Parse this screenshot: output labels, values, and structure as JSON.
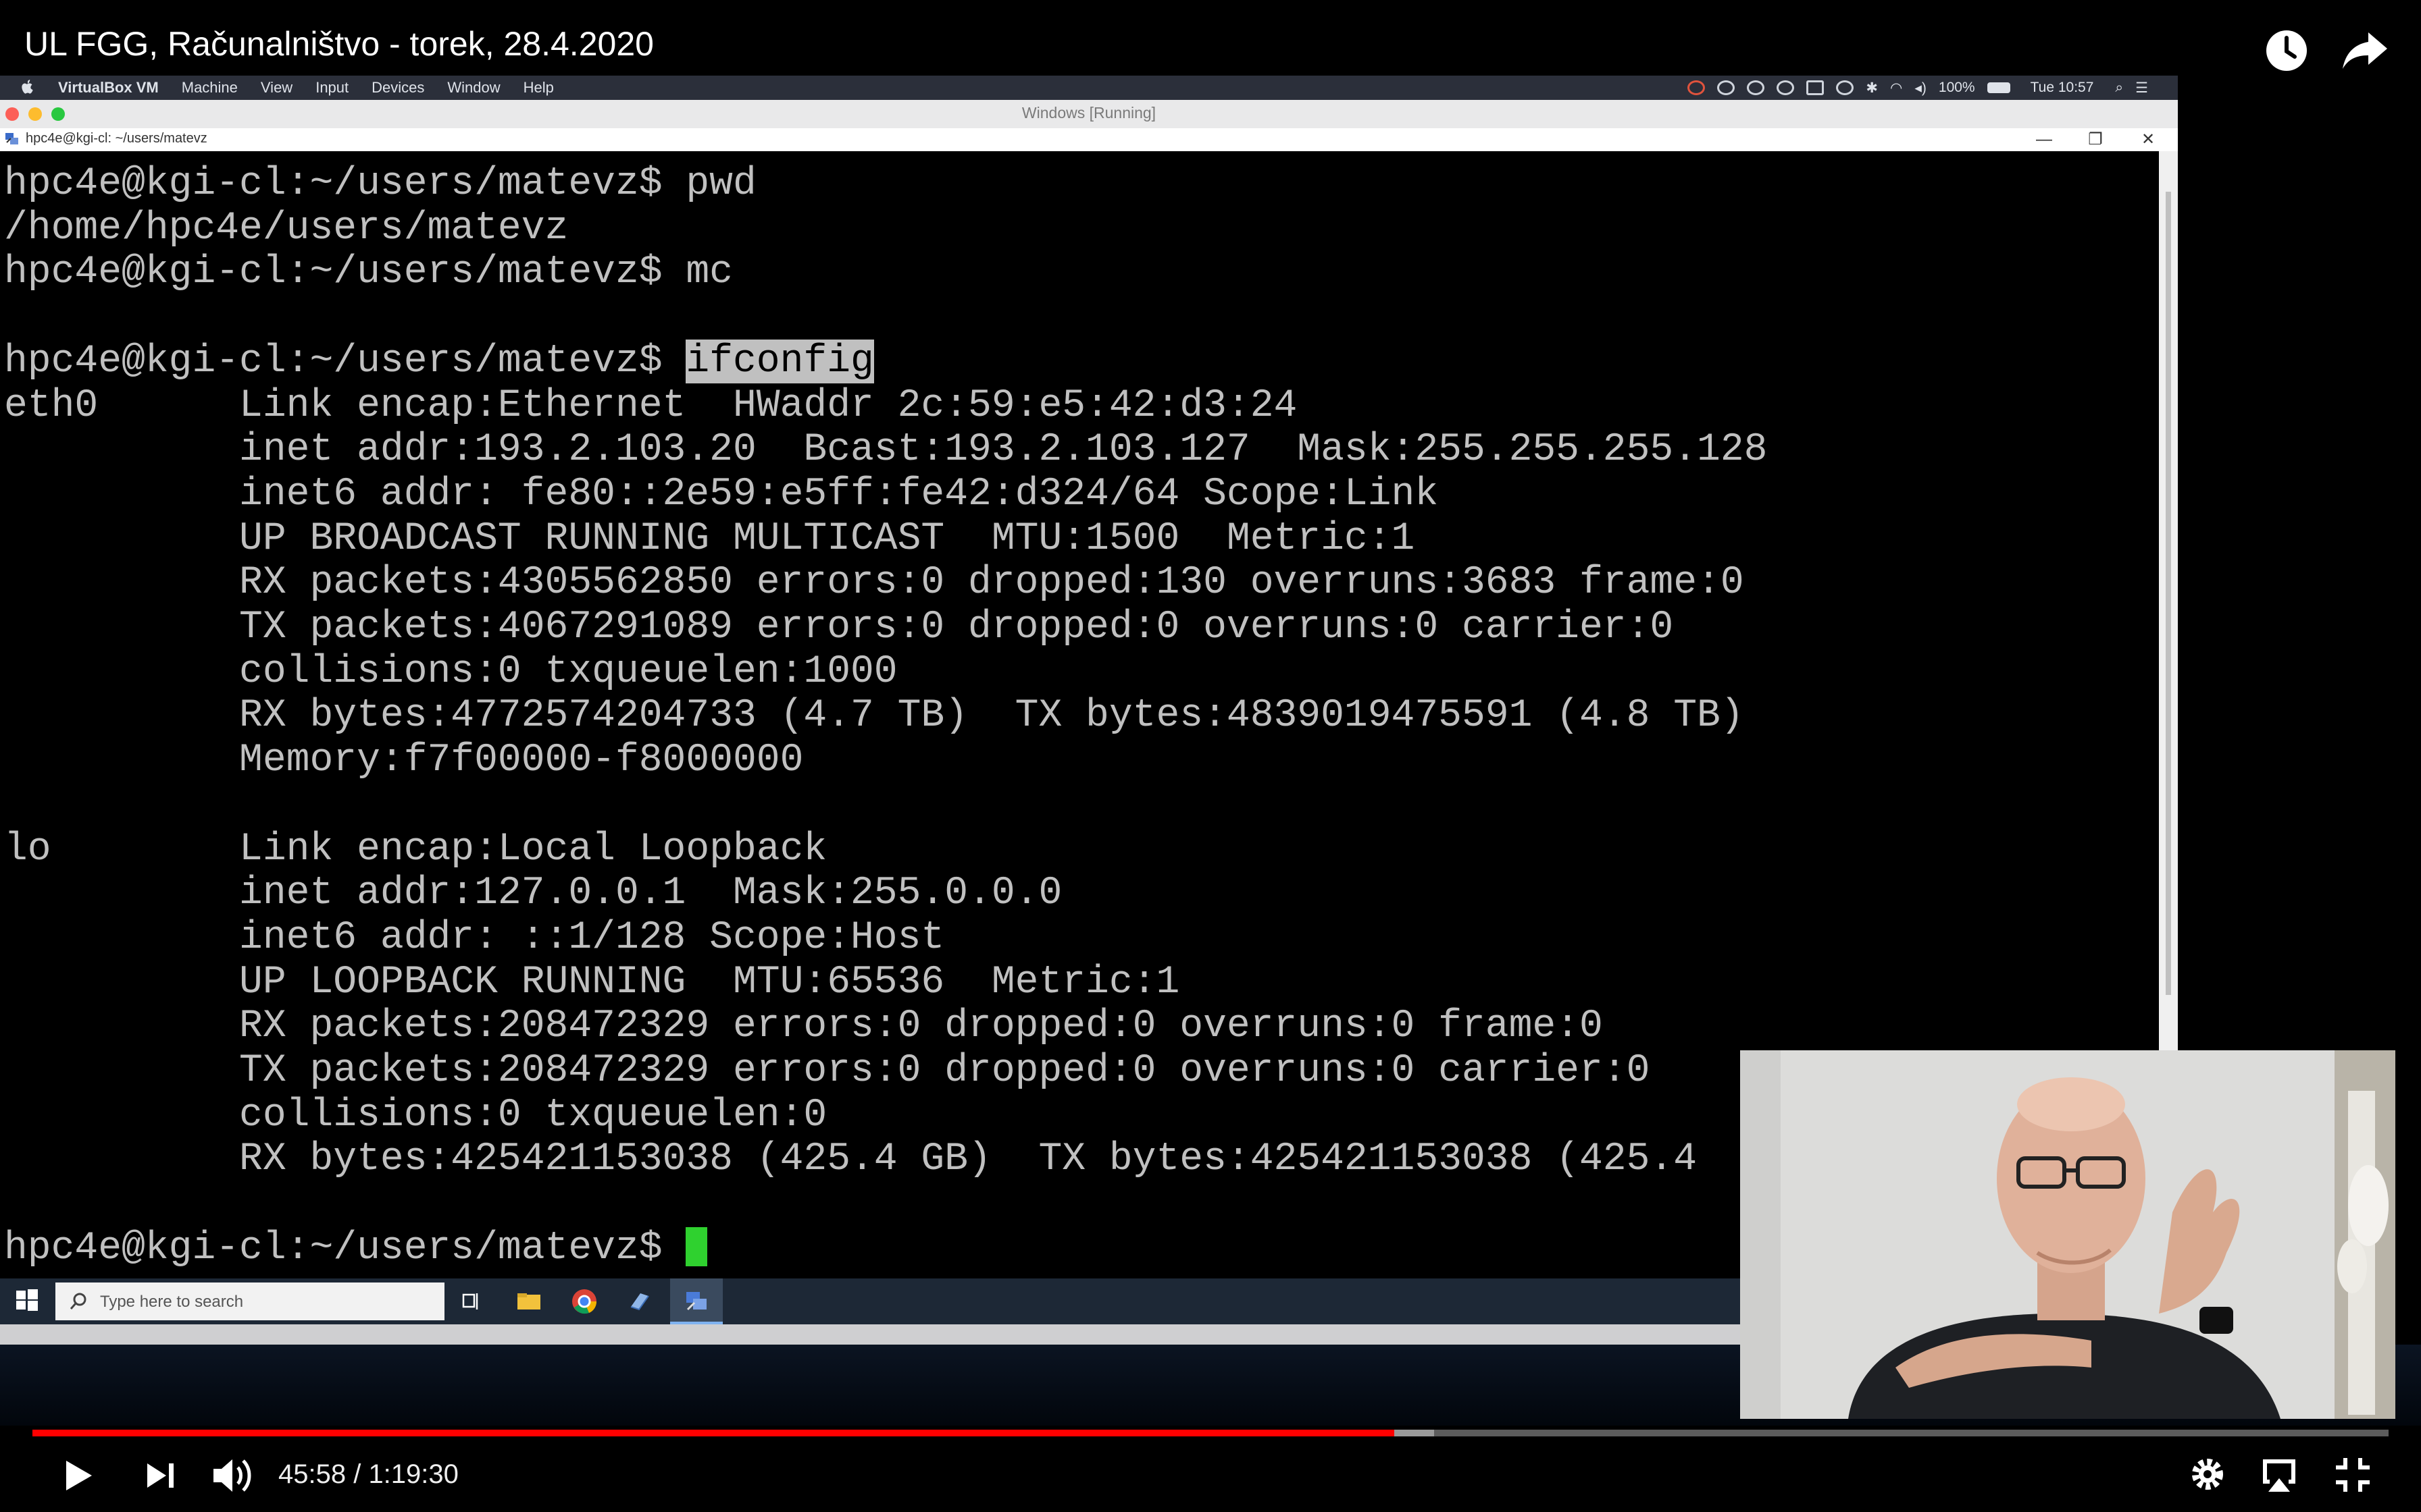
{
  "player": {
    "title": "UL FGG, Računalništvo - torek, 28.4.2020",
    "time_current": "45:58",
    "time_total": "1:19:30",
    "time_display": "45:58 / 1:19:30",
    "progress_played": 0.578,
    "progress_buffered": 0.595,
    "accent_color": "#ff0000"
  },
  "mac_menubar": {
    "items": [
      "VirtualBox VM",
      "Machine",
      "View",
      "Input",
      "Devices",
      "Window",
      "Help"
    ],
    "battery": "100%",
    "clock": "Tue 10:57"
  },
  "vbox": {
    "window_title": "Windows [Running]"
  },
  "putty": {
    "window_title": "hpc4e@kgi-cl: ~/users/matevz",
    "min": "—",
    "max": "❐",
    "close": "✕"
  },
  "terminal": {
    "before_highlight": "hpc4e@kgi-cl:~/users/matevz$ pwd\n/home/hpc4e/users/matevz\nhpc4e@kgi-cl:~/users/matevz$ mc\n\nhpc4e@kgi-cl:~/users/matevz$ ",
    "highlight": "ifconfig",
    "after_highlight": "\neth0      Link encap:Ethernet  HWaddr 2c:59:e5:42:d3:24\n          inet addr:193.2.103.20  Bcast:193.2.103.127  Mask:255.255.255.128\n          inet6 addr: fe80::2e59:e5ff:fe42:d324/64 Scope:Link\n          UP BROADCAST RUNNING MULTICAST  MTU:1500  Metric:1\n          RX packets:4305562850 errors:0 dropped:130 overruns:3683 frame:0\n          TX packets:4067291089 errors:0 dropped:0 overruns:0 carrier:0\n          collisions:0 txqueuelen:1000\n          RX bytes:4772574204733 (4.7 TB)  TX bytes:4839019475591 (4.8 TB)\n          Memory:f7f00000-f8000000\n\nlo        Link encap:Local Loopback\n          inet addr:127.0.0.1  Mask:255.0.0.0\n          inet6 addr: ::1/128 Scope:Host\n          UP LOOPBACK RUNNING  MTU:65536  Metric:1\n          RX packets:208472329 errors:0 dropped:0 overruns:0 frame:0\n          TX packets:208472329 errors:0 dropped:0 overruns:0 carrier:0\n          collisions:0 txqueuelen:0\n          RX bytes:425421153038 (425.4 GB)  TX bytes:425421153038 (425.4\n\nhpc4e@kgi-cl:~/users/matevz$ ",
    "cursor_color": "#2fd12f"
  },
  "taskbar": {
    "search_placeholder": "Type here to search"
  }
}
